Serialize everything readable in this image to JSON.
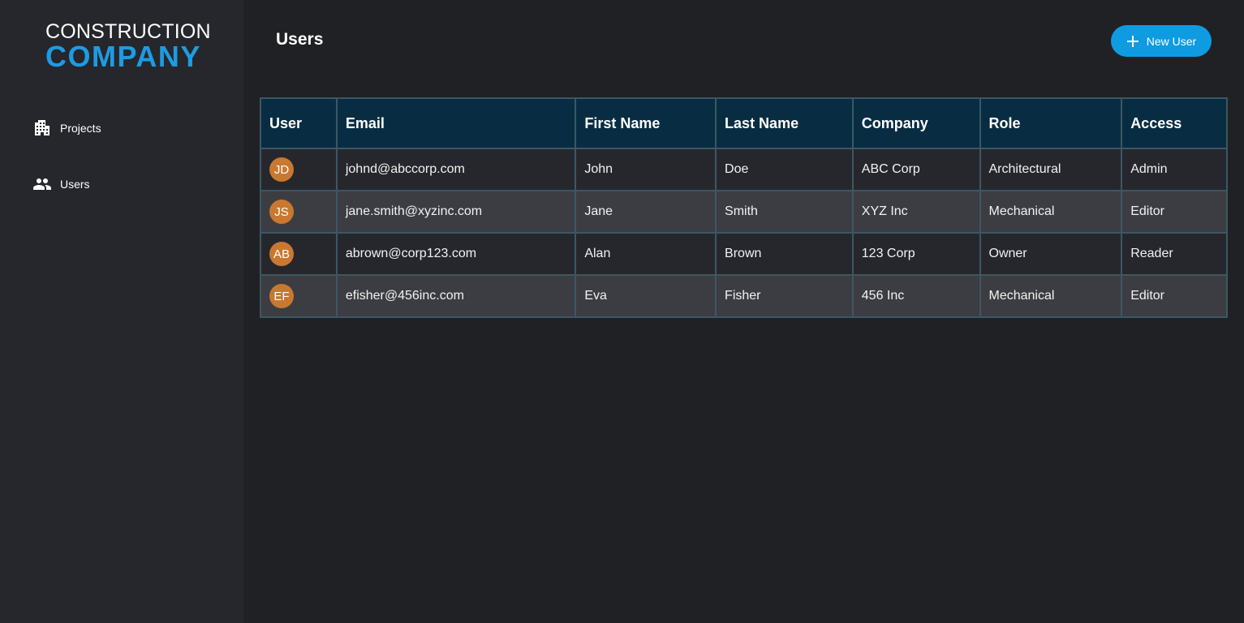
{
  "logo": {
    "line1": "CONSTRUCTION",
    "line2": "COMPANY"
  },
  "sidebar": {
    "items": [
      {
        "label": "Projects",
        "icon": "building-icon"
      },
      {
        "label": "Users",
        "icon": "users-icon"
      }
    ]
  },
  "header": {
    "title": "Users",
    "new_user_label": "New User"
  },
  "table": {
    "columns": [
      "User",
      "Email",
      "First Name",
      "Last Name",
      "Company",
      "Role",
      "Access"
    ],
    "rows": [
      {
        "initials": "JD",
        "email": "johnd@abccorp.com",
        "first": "John",
        "last": "Doe",
        "company": "ABC Corp",
        "role": "Architectural",
        "access": "Admin"
      },
      {
        "initials": "JS",
        "email": "jane.smith@xyzinc.com",
        "first": "Jane",
        "last": "Smith",
        "company": "XYZ Inc",
        "role": "Mechanical",
        "access": "Editor"
      },
      {
        "initials": "AB",
        "email": "abrown@corp123.com",
        "first": "Alan",
        "last": "Brown",
        "company": "123 Corp",
        "role": "Owner",
        "access": "Reader"
      },
      {
        "initials": "EF",
        "email": "efisher@456inc.com",
        "first": "Eva",
        "last": "Fisher",
        "company": "456 Inc",
        "role": "Mechanical",
        "access": "Editor"
      }
    ]
  },
  "colors": {
    "accent": "#0f9be2",
    "logo_blue": "#1e9be2",
    "avatar": "#c8792f",
    "header_bg": "#082d43",
    "border": "#3c5764"
  }
}
